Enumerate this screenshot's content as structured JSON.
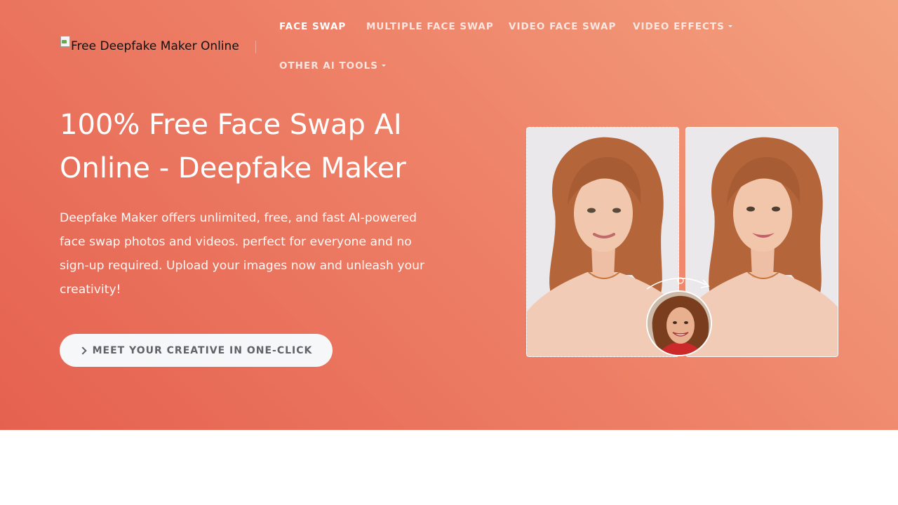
{
  "header": {
    "logo_alt": "Free Deepfake Maker Online"
  },
  "nav": {
    "items": [
      {
        "label": "FACE SWAP",
        "active": true,
        "dropdown": false
      },
      {
        "label": "MULTIPLE FACE SWAP",
        "active": false,
        "dropdown": false
      },
      {
        "label": "VIDEO FACE SWAP",
        "active": false,
        "dropdown": false
      },
      {
        "label": "VIDEO EFFECTS",
        "active": false,
        "dropdown": true
      },
      {
        "label": "OTHER AI TOOLS",
        "active": false,
        "dropdown": true
      }
    ]
  },
  "hero": {
    "title": "100% Free Face Swap AI Online - Deepfake Maker",
    "description": "Deepfake Maker offers unlimited, free, and fast AI-powered face swap photos and videos. perfect for everyone and no sign-up required. Upload your images now and unleash your creativity!",
    "cta_label": "MEET YOUR CREATIVE IN ONE-CLICK"
  },
  "icons": {
    "cta": "chevron-right-icon",
    "dropdown": "caret-down-icon",
    "swap": "curved-arrow-icon"
  },
  "colors": {
    "hero_gradient_start": "#e5614f",
    "hero_gradient_end": "#f3a27f",
    "cta_background": "#f6f7f9",
    "cta_text": "#5f6368"
  }
}
